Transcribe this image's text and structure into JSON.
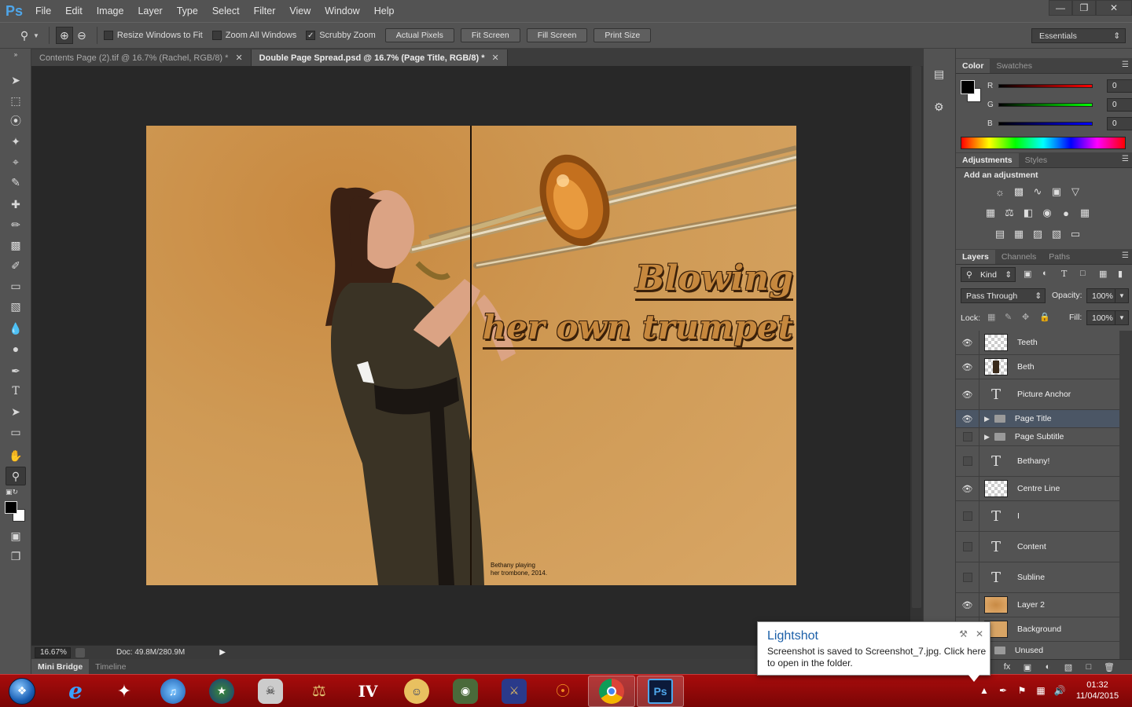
{
  "app": {
    "logo": "Ps",
    "menu": [
      "File",
      "Edit",
      "Image",
      "Layer",
      "Type",
      "Select",
      "Filter",
      "View",
      "Window",
      "Help"
    ]
  },
  "options": {
    "resize_windows": "Resize Windows to Fit",
    "zoom_all": "Zoom All Windows",
    "scrubby_zoom": "Scrubby Zoom",
    "actual_pixels": "Actual Pixels",
    "fit_screen": "Fit Screen",
    "fill_screen": "Fill Screen",
    "print_size": "Print Size",
    "workspace": "Essentials"
  },
  "tabs": [
    {
      "label": "Contents Page (2).tif @ 16.7% (Rachel, RGB/8) *",
      "active": false
    },
    {
      "label": "Double Page Spread.psd @ 16.7% (Page Title, RGB/8) *",
      "active": true
    }
  ],
  "document": {
    "title_line1": "Blowing",
    "title_line2": "her own trumpet",
    "caption_line1": "Bethany playing",
    "caption_line2": "her trombone, 2014."
  },
  "status": {
    "zoom": "16.67%",
    "doc": "Doc: 49.8M/280.9M"
  },
  "bottom_tabs": [
    "Mini Bridge",
    "Timeline"
  ],
  "color_panel": {
    "tabs": [
      "Color",
      "Swatches"
    ],
    "r_label": "R",
    "g_label": "G",
    "b_label": "B",
    "r": "0",
    "g": "0",
    "b": "0"
  },
  "adjustments": {
    "tabs": [
      "Adjustments",
      "Styles"
    ],
    "heading": "Add an adjustment"
  },
  "layers_panel": {
    "tabs": [
      "Layers",
      "Channels",
      "Paths"
    ],
    "kind": "Kind",
    "blend_mode": "Pass Through",
    "opacity_label": "Opacity:",
    "opacity": "100%",
    "lock_label": "Lock:",
    "fill_label": "Fill:",
    "fill": "100%",
    "layers": [
      {
        "name": "Teeth",
        "visible": true,
        "type": "checker"
      },
      {
        "name": "Beth",
        "visible": true,
        "type": "photo"
      },
      {
        "name": "Picture Anchor",
        "visible": true,
        "type": "text"
      },
      {
        "name": "Page Title",
        "visible": true,
        "type": "group",
        "selected": true
      },
      {
        "name": "Page Subtitle",
        "visible": false,
        "type": "group"
      },
      {
        "name": "Bethany!",
        "visible": false,
        "type": "text"
      },
      {
        "name": "Centre Line",
        "visible": true,
        "type": "checker"
      },
      {
        "name": "I",
        "visible": false,
        "type": "text"
      },
      {
        "name": "Content",
        "visible": false,
        "type": "text"
      },
      {
        "name": "Subline",
        "visible": false,
        "type": "text"
      },
      {
        "name": "Layer 2",
        "visible": true,
        "type": "orange"
      },
      {
        "name": "Background",
        "visible": true,
        "type": "orangesolid"
      },
      {
        "name": "Unused",
        "visible": false,
        "type": "group"
      }
    ]
  },
  "toast": {
    "title": "Lightshot",
    "message": "Screenshot is saved to Screenshot_7.jpg. Click here to open in the folder."
  },
  "clock": {
    "time": "01:32",
    "date": "11/04/2015"
  },
  "colors": {
    "accent": "#4ea6ea",
    "taskbar": "#a80c0c",
    "selected_layer": "#4b5665"
  }
}
